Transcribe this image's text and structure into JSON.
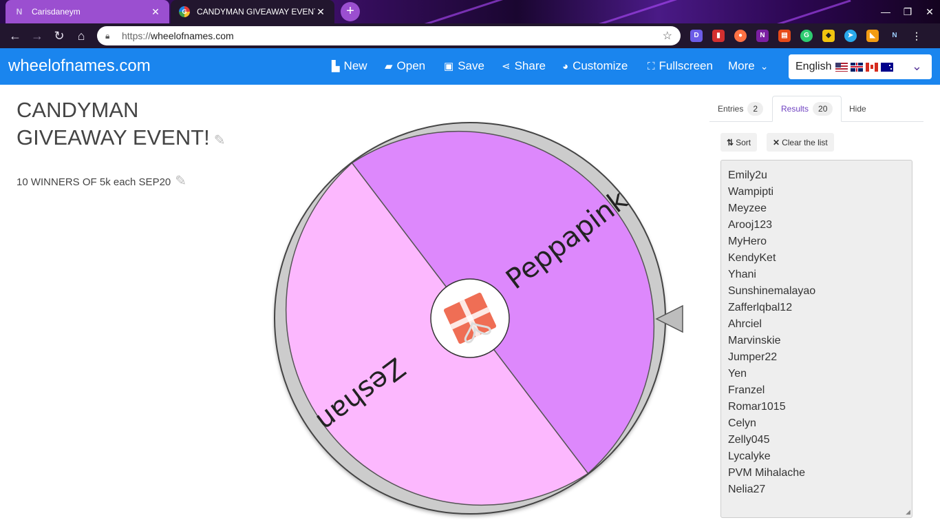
{
  "browser": {
    "tabs": [
      {
        "title": "Carisdaneym",
        "favicon": "N"
      },
      {
        "title": "CANDYMAN GIVEAWAY EVENT!",
        "favicon": "G"
      }
    ],
    "url_scheme": "https://",
    "url_host": "wheelofnames.com"
  },
  "site": {
    "brand": "wheelofnames.com",
    "menu": [
      {
        "label": "New",
        "icon": "file-icon"
      },
      {
        "label": "Open",
        "icon": "folder-open-icon"
      },
      {
        "label": "Save",
        "icon": "floppy-icon"
      },
      {
        "label": "Share",
        "icon": "share-icon"
      },
      {
        "label": "Customize",
        "icon": "palette-icon"
      },
      {
        "label": "Fullscreen",
        "icon": "fullscreen-icon"
      },
      {
        "label": "More",
        "icon": "chevron-down-icon"
      }
    ],
    "language": "English"
  },
  "wheel": {
    "title": "CANDYMAN GIVEAWAY EVENT!",
    "description": "10 WINNERS OF 5k each SEP20",
    "segments": [
      {
        "name": "Peppapink",
        "color": "#dd88fc"
      },
      {
        "name": "Zeshan",
        "color": "#fcb8fe"
      }
    ]
  },
  "panel": {
    "tabs": [
      {
        "label": "Entries",
        "count": "2"
      },
      {
        "label": "Results",
        "count": "20"
      },
      {
        "label": "Hide"
      }
    ],
    "sort_label": "Sort",
    "clear_label": "Clear the list",
    "results": [
      "Emily2u",
      "Wampipti",
      "Meyzee",
      "Arooj123",
      "MyHero",
      "KendyKet",
      "Yhani",
      "Sunshinemalayao",
      "Zafferlqbal12",
      "Ahrciel",
      "Marvinskie",
      "Jumper22",
      "Yen",
      "Franzel",
      "Romar1015",
      "Celyn",
      "Zelly045",
      "Lycalyke",
      "PVM Mihalache",
      "Nelia27"
    ]
  },
  "colors": {
    "header": "#1a85ee",
    "accent": "#6f42c1"
  }
}
